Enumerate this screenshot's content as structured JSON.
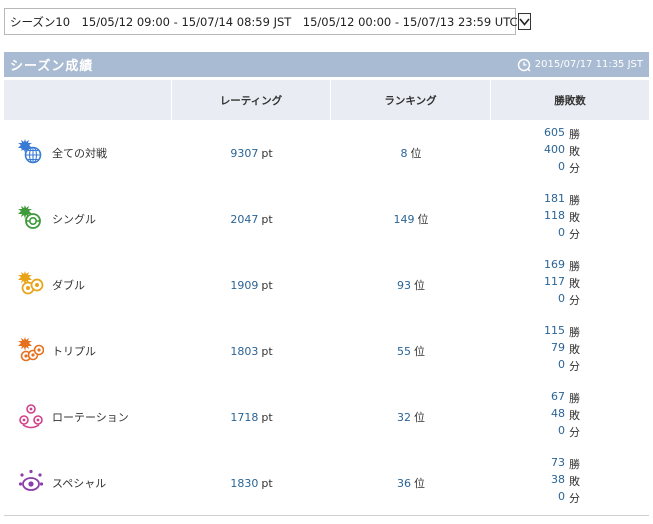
{
  "season_selector": {
    "value": "シーズン10　15/05/12 09:00 - 15/07/14 08:59 JST　15/05/12 00:00 - 15/07/13 23:59 UTC"
  },
  "header": {
    "title": "シーズン成績",
    "updated": "2015/07/17 11:35 JST"
  },
  "columns": {
    "rating": "レーティング",
    "ranking": "ランキング",
    "record": "勝敗数"
  },
  "units": {
    "rating": "pt",
    "rank": "位",
    "win": "勝",
    "loss": "敗",
    "draw": "分"
  },
  "colors": {
    "header_bg": "#a9bbd2",
    "column_header_bg": "#e9edf3",
    "link_blue": "#2a6496"
  },
  "rows": [
    {
      "label": "全ての対戦",
      "icon": "globe-icon",
      "rating": "9307",
      "rank": "8",
      "wins": "605",
      "losses": "400",
      "draws": "0"
    },
    {
      "label": "シングル",
      "icon": "single-battle-icon",
      "rating": "2047",
      "rank": "149",
      "wins": "181",
      "losses": "118",
      "draws": "0"
    },
    {
      "label": "ダブル",
      "icon": "double-battle-icon",
      "rating": "1909",
      "rank": "93",
      "wins": "169",
      "losses": "117",
      "draws": "0"
    },
    {
      "label": "トリプル",
      "icon": "triple-battle-icon",
      "rating": "1803",
      "rank": "55",
      "wins": "115",
      "losses": "79",
      "draws": "0"
    },
    {
      "label": "ローテーション",
      "icon": "rotation-battle-icon",
      "rating": "1718",
      "rank": "32",
      "wins": "67",
      "losses": "48",
      "draws": "0"
    },
    {
      "label": "スペシャル",
      "icon": "special-battle-icon",
      "rating": "1830",
      "rank": "36",
      "wins": "73",
      "losses": "38",
      "draws": "0"
    }
  ]
}
